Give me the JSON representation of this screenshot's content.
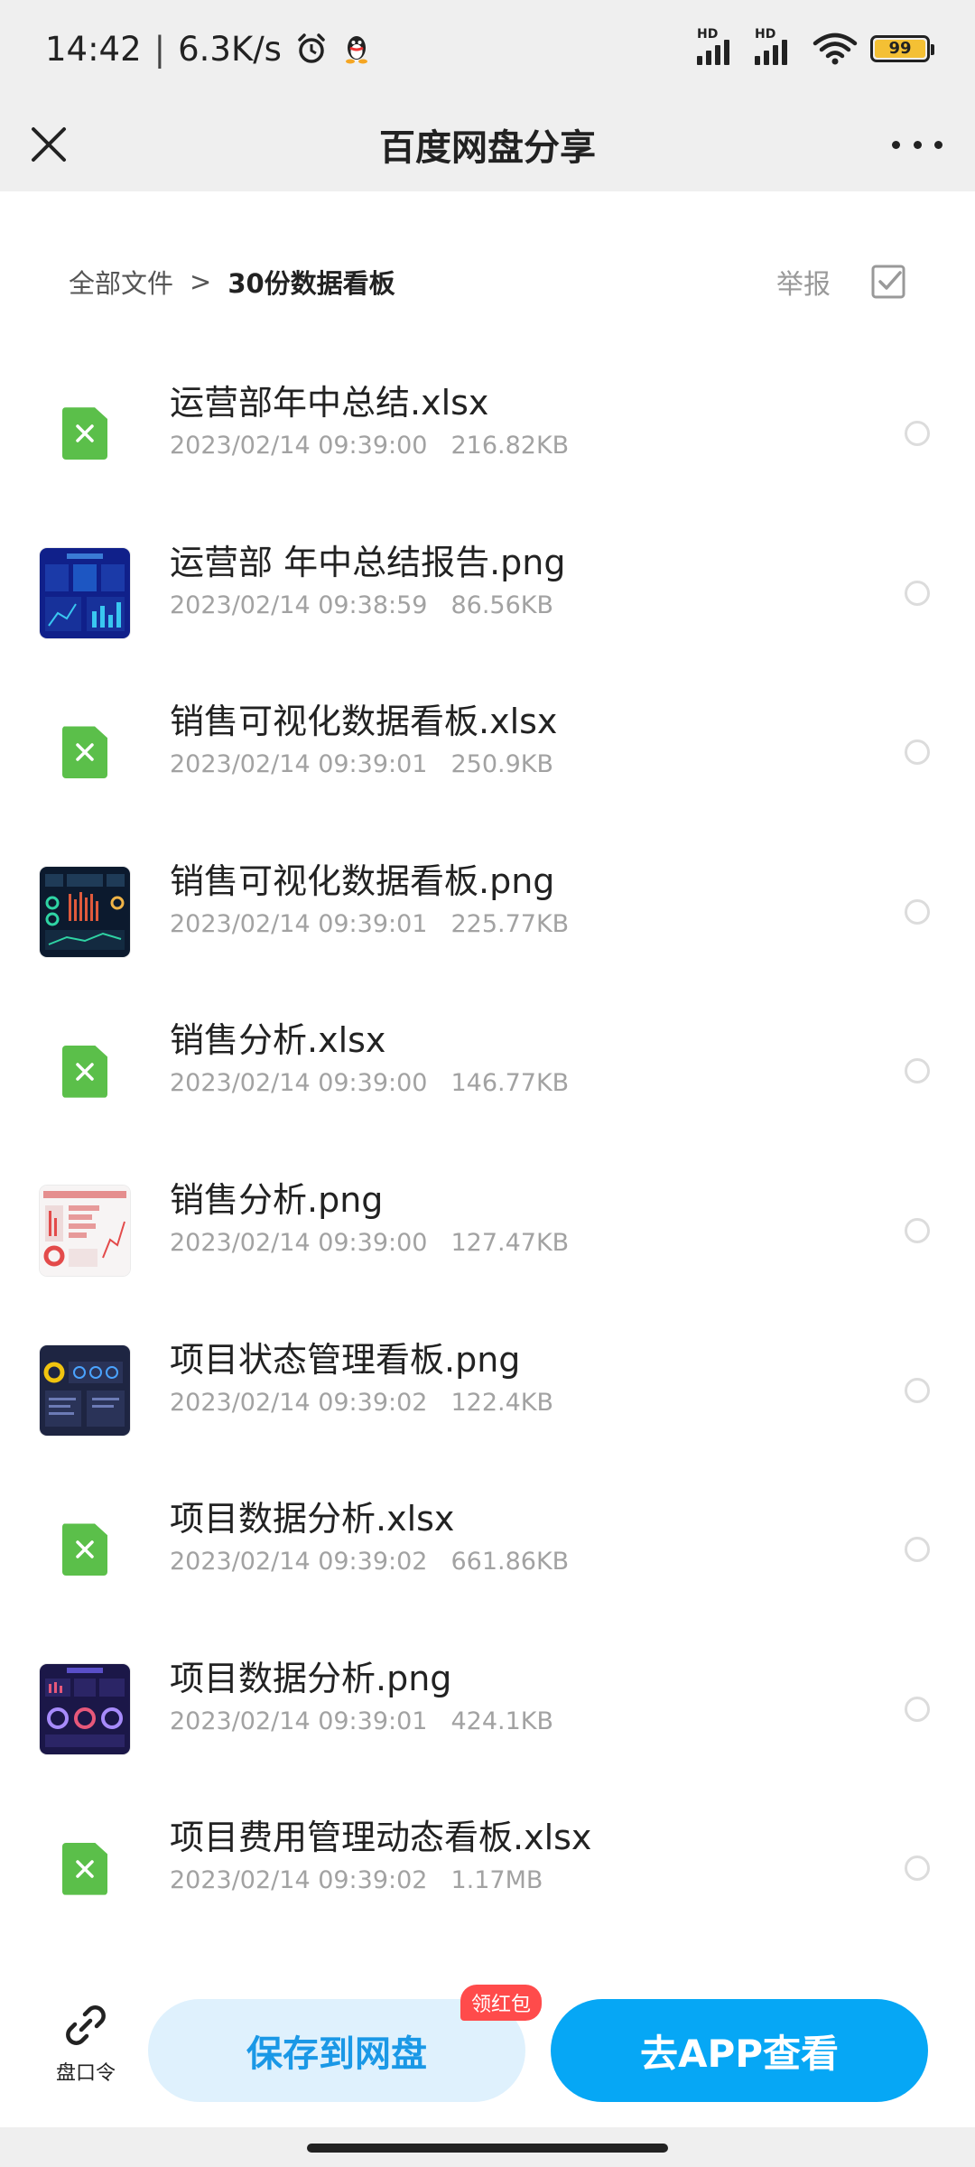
{
  "status_bar": {
    "time": "14:42",
    "separator": "|",
    "speed": "6.3K/s",
    "battery": "99"
  },
  "header": {
    "title": "百度网盘分享"
  },
  "breadcrumb": {
    "root": "全部文件",
    "separator": ">",
    "current": "30份数据看板",
    "report": "举报"
  },
  "files": [
    {
      "name": "运营部年中总结.xlsx",
      "date": "2023/02/14 09:39:00",
      "size": "216.82KB",
      "type": "xlsx"
    },
    {
      "name": "运营部 年中总结报告.png",
      "date": "2023/02/14 09:38:59",
      "size": "86.56KB",
      "type": "png"
    },
    {
      "name": "销售可视化数据看板.xlsx",
      "date": "2023/02/14 09:39:01",
      "size": "250.9KB",
      "type": "xlsx"
    },
    {
      "name": "销售可视化数据看板.png",
      "date": "2023/02/14 09:39:01",
      "size": "225.77KB",
      "type": "png"
    },
    {
      "name": "销售分析.xlsx",
      "date": "2023/02/14 09:39:00",
      "size": "146.77KB",
      "type": "xlsx"
    },
    {
      "name": "销售分析.png",
      "date": "2023/02/14 09:39:00",
      "size": "127.47KB",
      "type": "png"
    },
    {
      "name": "项目状态管理看板.png",
      "date": "2023/02/14 09:39:02",
      "size": "122.4KB",
      "type": "png"
    },
    {
      "name": "项目数据分析.xlsx",
      "date": "2023/02/14 09:39:02",
      "size": "661.86KB",
      "type": "xlsx"
    },
    {
      "name": "项目数据分析.png",
      "date": "2023/02/14 09:39:01",
      "size": "424.1KB",
      "type": "png"
    },
    {
      "name": "项目费用管理动态看板.xlsx",
      "date": "2023/02/14 09:39:02",
      "size": "1.17MB",
      "type": "xlsx"
    }
  ],
  "bottom_bar": {
    "share_code_label": "盘口令",
    "save_button": "保存到网盘",
    "redpacket_badge": "领红包",
    "open_app_button": "去APP查看"
  },
  "colors": {
    "accent": "#06a7f5",
    "save_bg": "#dff1fd",
    "badge": "#ff4b4b",
    "xlsx_green": "#5bbf4a"
  }
}
